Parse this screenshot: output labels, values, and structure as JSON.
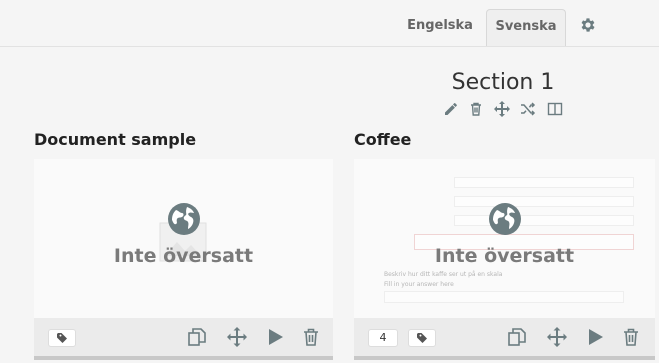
{
  "header": {
    "languages": [
      {
        "label": "Engelska",
        "active": false
      },
      {
        "label": "Svenska",
        "active": true
      }
    ],
    "settings_icon": "gear-icon"
  },
  "section": {
    "title": "Section 1",
    "tools": [
      "pencil-icon",
      "trash-icon",
      "move-icon",
      "shuffle-icon",
      "columns-icon"
    ]
  },
  "cards": [
    {
      "title": "Document sample",
      "overlay_text": "Inte översatt",
      "tag_icon": "tag-icon",
      "count": null,
      "actions": [
        "copy-icon",
        "move-icon",
        "play-icon",
        "trash-icon"
      ]
    },
    {
      "title": "Coffee",
      "overlay_text": "Inte översatt",
      "tag_icon": "tag-icon",
      "count": "4",
      "actions": [
        "copy-icon",
        "move-icon",
        "play-icon",
        "trash-icon"
      ],
      "preview_text": [
        "Beskriv hur ditt kaffe ser ut på en skala",
        "Fill in your answer here"
      ]
    }
  ],
  "colors": {
    "background": "#f5f5f5",
    "icon": "#6b7c80",
    "overlay_text": "#7a7a7a"
  }
}
